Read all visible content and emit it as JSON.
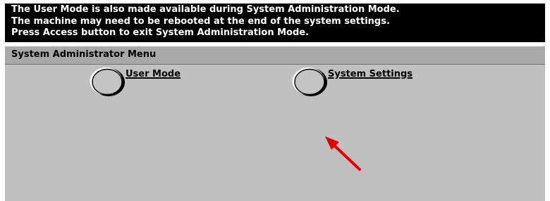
{
  "message_bar": {
    "lines": [
      "The User Mode is also made available during System Administration Mode.",
      "The machine may need to be rebooted at the end of the system settings.",
      "Press Access button to exit System Administration Mode."
    ]
  },
  "menu": {
    "title": "System Administrator Menu",
    "buttons": {
      "user_mode": "User Mode",
      "system_settings": "System Settings"
    }
  },
  "colors": {
    "message_bg": "#000000",
    "message_text": "#ffffff",
    "panel_bg": "#c0c0c0",
    "title_bar_bg": "#a8a8a8",
    "annotation_arrow": "#e60000"
  },
  "icons": {
    "mode_button": "round-button-icon",
    "annotation": "red-arrow-icon"
  }
}
